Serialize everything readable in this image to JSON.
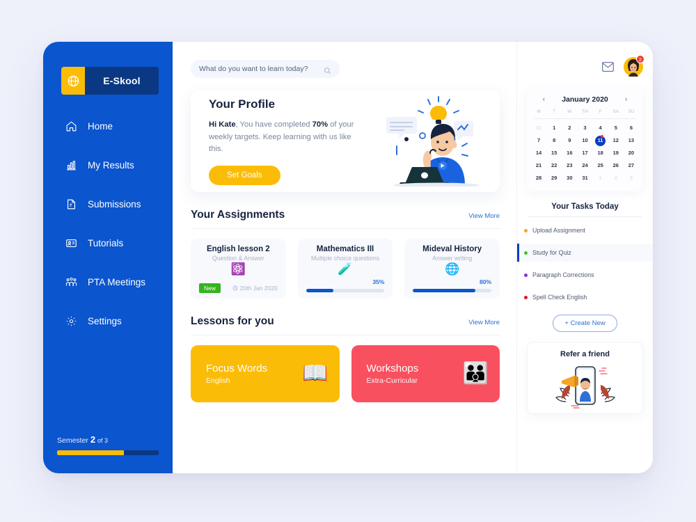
{
  "brand": {
    "name": "E-Skool",
    "logo_icon": "globe-icon",
    "accent_yellow": "#fbbc08",
    "accent_blue": "#0b55ce",
    "navy": "#0b3882"
  },
  "sidebar": {
    "items": [
      {
        "label": "Home",
        "icon": "home-icon"
      },
      {
        "label": "My Results",
        "icon": "bar-chart-icon"
      },
      {
        "label": "Submissions",
        "icon": "document-edit-icon"
      },
      {
        "label": "Tutorials",
        "icon": "id-card-icon"
      },
      {
        "label": "PTA  Meetings",
        "icon": "people-icon"
      },
      {
        "label": "Settings",
        "icon": "gear-icon"
      }
    ],
    "semester": {
      "prefix": "Semester",
      "number": "2",
      "suffix": "of 3",
      "progress_pct": 66
    }
  },
  "search": {
    "placeholder": "What do you want to learn today?",
    "value": "",
    "icon": "search-icon"
  },
  "topbar": {
    "mail_icon": "mail-icon",
    "avatar_icon": "avatar",
    "avatar_badge": "2"
  },
  "profile": {
    "title": "Your Profile",
    "greeting": "Hi Kate",
    "text_mid": ", You have completed ",
    "percent": "70%",
    "text_end": " of your weekly targets. Keep learning with us like this.",
    "button": "Set Goals"
  },
  "assignments": {
    "title": "Your Assignments",
    "view_more": "View More",
    "cards": [
      {
        "title": "English lesson 2",
        "subtitle": "Question & Answer",
        "emoji": "⚛️",
        "badge": "New",
        "due": "20th Jan 2020",
        "progress": null,
        "progress_label": null
      },
      {
        "title": "Mathematics III",
        "subtitle": "Multiple choice questions",
        "emoji": "🧪",
        "badge": null,
        "due": null,
        "progress": 35,
        "progress_label": "35%"
      },
      {
        "title": "Mideval History",
        "subtitle": "Answer writing",
        "emoji": "🌐",
        "badge": null,
        "due": null,
        "progress": 80,
        "progress_label": "80%"
      }
    ]
  },
  "lessons": {
    "title": "Lessons for you",
    "view_more": "View More",
    "cards": [
      {
        "title": "Focus Words",
        "subtitle": "English",
        "emoji": "📖",
        "color": "#fbbc08"
      },
      {
        "title": "Workshops",
        "subtitle": "Extra-Curricular",
        "emoji": "👪",
        "color": "#f9505f"
      }
    ]
  },
  "calendar": {
    "month": "January 2020",
    "prev_icon": "chevron-left-icon",
    "next_icon": "chevron-right-icon",
    "dow": [
      "M",
      "T",
      "W",
      "TH",
      "F",
      "SA",
      "SU"
    ],
    "weeks": [
      [
        {
          "d": "31",
          "mute": true
        },
        {
          "d": "1"
        },
        {
          "d": "2"
        },
        {
          "d": "3"
        },
        {
          "d": "4"
        },
        {
          "d": "5"
        },
        {
          "d": "6"
        }
      ],
      [
        {
          "d": "7"
        },
        {
          "d": "8"
        },
        {
          "d": "9"
        },
        {
          "d": "10"
        },
        {
          "d": "11",
          "sel": true
        },
        {
          "d": "12"
        },
        {
          "d": "13"
        }
      ],
      [
        {
          "d": "14"
        },
        {
          "d": "15"
        },
        {
          "d": "16"
        },
        {
          "d": "17"
        },
        {
          "d": "18"
        },
        {
          "d": "19"
        },
        {
          "d": "20"
        }
      ],
      [
        {
          "d": "21"
        },
        {
          "d": "22"
        },
        {
          "d": "23"
        },
        {
          "d": "24"
        },
        {
          "d": "25"
        },
        {
          "d": "26"
        },
        {
          "d": "27"
        }
      ],
      [
        {
          "d": "28"
        },
        {
          "d": "29"
        },
        {
          "d": "30"
        },
        {
          "d": "31"
        },
        {
          "d": "1",
          "mute": true
        },
        {
          "d": "2",
          "mute": true
        },
        {
          "d": "3",
          "mute": true
        }
      ]
    ]
  },
  "tasks": {
    "title": "Your Tasks Today",
    "items": [
      {
        "label": "Upload Assignment",
        "color": "#f5a623",
        "active": false
      },
      {
        "label": "Study for Quiz",
        "color": "#46c51b",
        "active": true
      },
      {
        "label": "Paragraph Corrections",
        "color": "#8c2fd6",
        "active": false
      },
      {
        "label": "Spell Check English",
        "color": "#e0162b",
        "active": false
      }
    ],
    "create_button": "+ Create New"
  },
  "refer": {
    "title": "Refer a friend",
    "image": "refer-illustration"
  }
}
